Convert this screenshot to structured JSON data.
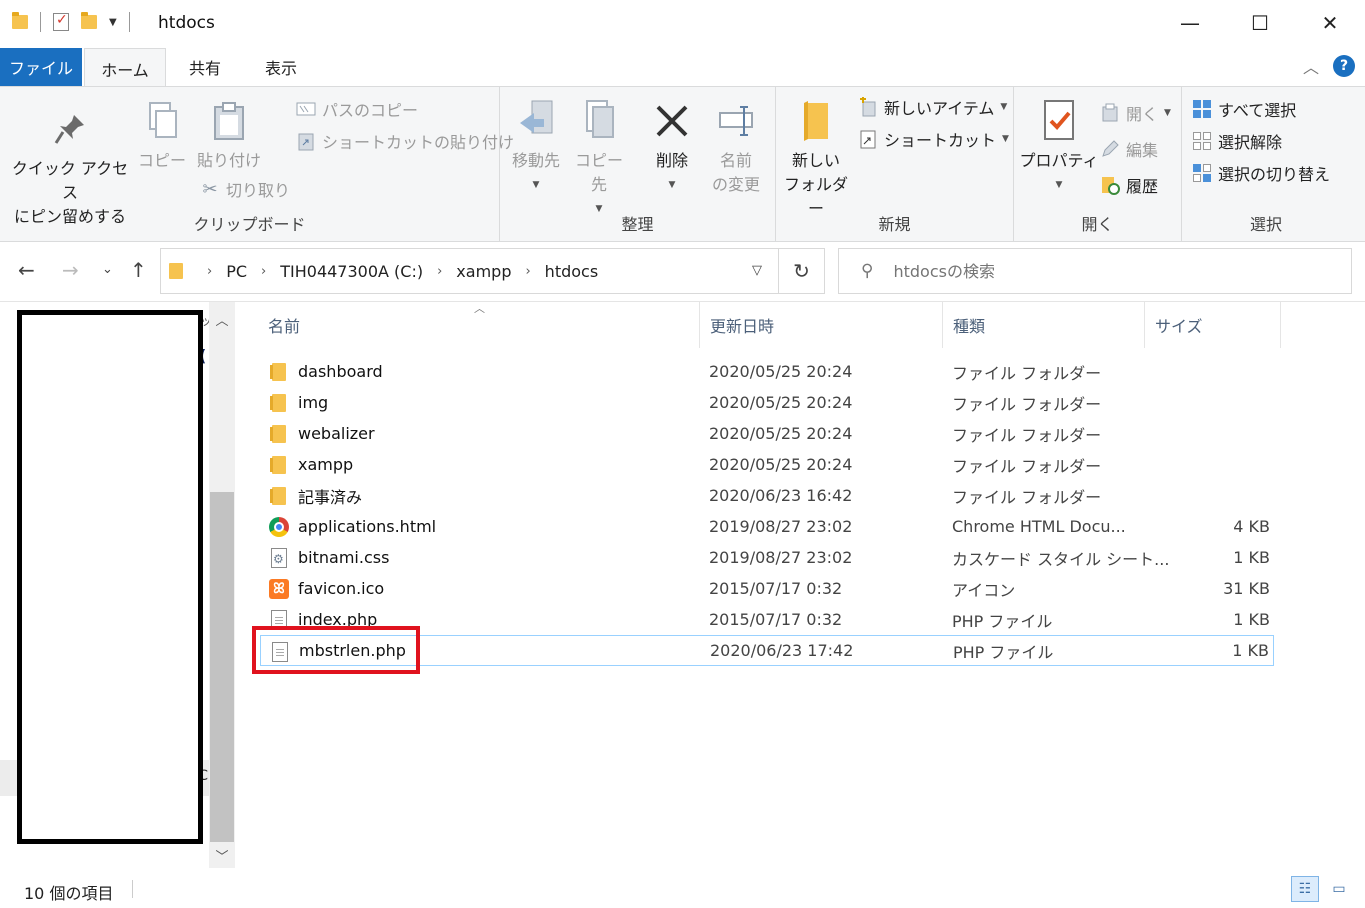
{
  "window": {
    "title": "htdocs",
    "minimize": "—",
    "maximize": "☐",
    "close": "✕"
  },
  "ribbon_tabs": {
    "file": "ファイル",
    "home": "ホーム",
    "share": "共有",
    "view": "表示",
    "help": "?"
  },
  "clipboard": {
    "pin_line1": "クイック アクセス",
    "pin_line2": "にピン留めする",
    "copy": "コピー",
    "paste": "貼り付け",
    "copy_path": "パスのコピー",
    "paste_shortcut": "ショートカットの貼り付け",
    "cut": "切り取り",
    "label": "クリップボード"
  },
  "organize": {
    "move_to": "移動先",
    "copy_to": "コピー先",
    "delete": "削除",
    "rename_line1": "名前",
    "rename_line2": "の変更",
    "label": "整理"
  },
  "new": {
    "new_folder_line1": "新しい",
    "new_folder_line2": "フォルダー",
    "new_item": "新しいアイテム",
    "shortcut": "ショートカット",
    "label": "新規"
  },
  "open": {
    "properties": "プロパティ",
    "open": "開く",
    "edit": "編集",
    "history": "履歴",
    "label": "開く"
  },
  "select": {
    "select_all": "すべて選択",
    "select_none": "選択解除",
    "invert": "選択の切り替え",
    "label": "選択"
  },
  "address": {
    "crumbs": [
      "PC",
      "TIH0447300A (C:)",
      "xampp",
      "htdocs"
    ],
    "search_placeholder": "htdocsの検索"
  },
  "columns": {
    "name": "名前",
    "date": "更新日時",
    "type": "種類",
    "size": "サイズ"
  },
  "files": [
    {
      "name": "dashboard",
      "date": "2020/05/25 20:24",
      "type": "ファイル フォルダー",
      "size": "",
      "icon": "folder-icon"
    },
    {
      "name": "img",
      "date": "2020/05/25 20:24",
      "type": "ファイル フォルダー",
      "size": "",
      "icon": "folder-icon"
    },
    {
      "name": "webalizer",
      "date": "2020/05/25 20:24",
      "type": "ファイル フォルダー",
      "size": "",
      "icon": "folder-icon"
    },
    {
      "name": "xampp",
      "date": "2020/05/25 20:24",
      "type": "ファイル フォルダー",
      "size": "",
      "icon": "folder-icon"
    },
    {
      "name": "記事済み",
      "date": "2020/06/23 16:42",
      "type": "ファイル フォルダー",
      "size": "",
      "icon": "folder-icon"
    },
    {
      "name": "applications.html",
      "date": "2019/08/27 23:02",
      "type": "Chrome HTML Docu...",
      "size": "4 KB",
      "icon": "chrome-icon"
    },
    {
      "name": "bitnami.css",
      "date": "2019/08/27 23:02",
      "type": "カスケード スタイル シート...",
      "size": "1 KB",
      "icon": "css-file-icon"
    },
    {
      "name": "favicon.ico",
      "date": "2015/07/17 0:32",
      "type": "アイコン",
      "size": "31 KB",
      "icon": "xampp-icon"
    },
    {
      "name": "index.php",
      "date": "2015/07/17 0:32",
      "type": "PHP ファイル",
      "size": "1 KB",
      "icon": "document-icon"
    },
    {
      "name": "mbstrlen.php",
      "date": "2020/06/23 17:42",
      "type": "PHP ファイル",
      "size": "1 KB",
      "icon": "document-icon"
    }
  ],
  "navpane": {
    "edge_text_bottom": "C"
  },
  "status": {
    "item_count": "10 個の項目"
  },
  "colors": {
    "accent": "#1a6fc0",
    "highlight_box": "#e0121e",
    "selection_border": "#99d1ff",
    "folder": "#f6c34f"
  }
}
